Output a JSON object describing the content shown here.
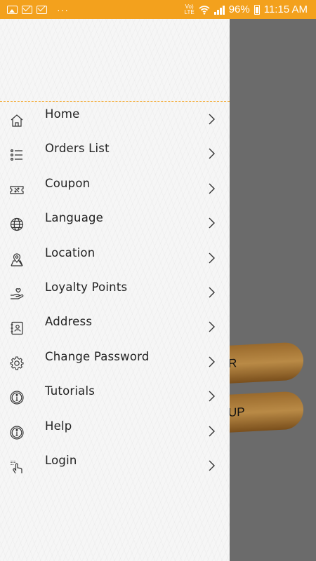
{
  "status_bar": {
    "background": "#f3a11d",
    "left_icons": [
      "image-icon",
      "mail-icon",
      "mail-icon"
    ],
    "more": "···",
    "volte": "Vo))\nLTE",
    "wifi": "wifi-icon",
    "signal": "signal-icon",
    "battery_percent": "96%",
    "time": "11:15 AM"
  },
  "background_app": {
    "card_labels": [
      "R",
      "UP"
    ]
  },
  "drawer": {
    "accent_color": "#f3a11d",
    "items": [
      {
        "label": "Home",
        "icon": "home-icon"
      },
      {
        "label": "Orders List",
        "icon": "list-icon"
      },
      {
        "label": "Coupon",
        "icon": "coupon-icon"
      },
      {
        "label": "Language",
        "icon": "globe-icon"
      },
      {
        "label": "Location",
        "icon": "map-pin-icon"
      },
      {
        "label": "Loyalty Points",
        "icon": "hand-heart-icon"
      },
      {
        "label": "Address",
        "icon": "address-book-icon"
      },
      {
        "label": "Change Password",
        "icon": "gear-icon"
      },
      {
        "label": "Tutorials",
        "icon": "info-icon"
      },
      {
        "label": "Help",
        "icon": "info-icon"
      },
      {
        "label": "Login",
        "icon": "login-tap-icon"
      }
    ]
  }
}
